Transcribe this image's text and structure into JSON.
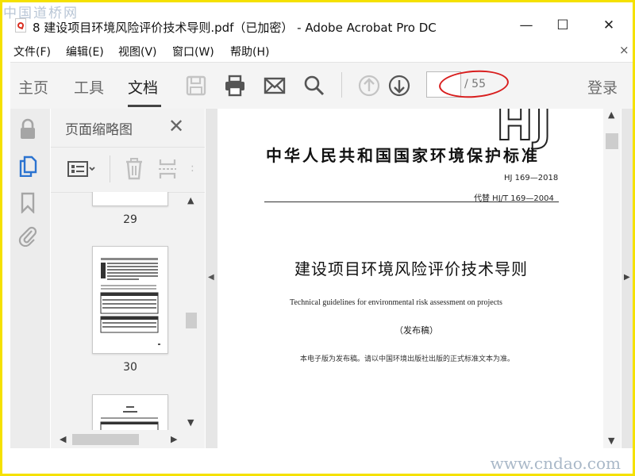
{
  "watermark": {
    "top": "中国道桥网",
    "bottom": "www.cndao.com"
  },
  "window": {
    "title": "8 建设项目环境风险评价技术导则.pdf（已加密） - Adobe Acrobat Pro DC",
    "controls": {
      "minimize": "—",
      "maximize": "☐",
      "close": "✕"
    }
  },
  "menu": {
    "items": [
      "文件(F)",
      "编辑(E)",
      "视图(V)",
      "窗口(W)",
      "帮助(H)"
    ],
    "close": "×"
  },
  "toolbar": {
    "tabs": [
      "主页",
      "工具",
      "文档"
    ],
    "active_tab": "文档",
    "page_current": "",
    "page_total": "/ 55",
    "login": "登录",
    "highlight_color": "#d81e1e"
  },
  "thumbnail_panel": {
    "title": "页面缩略图",
    "close": "✕",
    "pages": [
      "29",
      "30"
    ]
  },
  "document": {
    "logo": "HJ",
    "heading": "中华人民共和国国家环境保护标准",
    "number": "HJ  169—2018",
    "replaces": "代替 HJ/T  169—2004",
    "main_title": "建设项目环境风险评价技术导则",
    "english_title": "Technical guidelines for environmental risk assessment on projects",
    "draft": "（发布稿）",
    "note": "本电子版为发布稿。请以中国环境出版社出版的正式标准文本为准。"
  },
  "colors": {
    "border": "#f5e100",
    "toolbar_bg": "#f4f4f4",
    "rail_bg": "#ececec",
    "accent_blue": "#2b73d0"
  }
}
